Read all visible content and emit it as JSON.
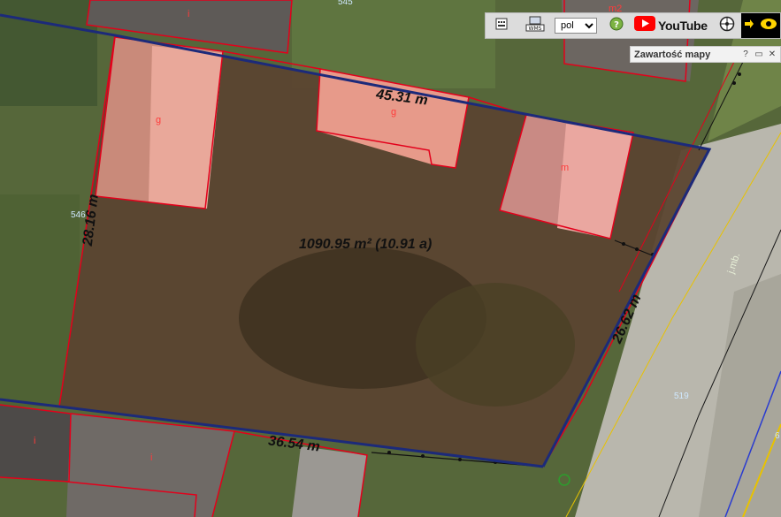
{
  "map": {
    "dimensions": {
      "top": "45.31 m",
      "left": "28.16 m",
      "right": "26.62 m",
      "bottom": "36.54 m"
    },
    "area": "1090.95 m² (10.91 a)",
    "plot_numbers": {
      "north": "545",
      "west": "546",
      "east": "519",
      "edge": "6"
    },
    "use_symbols": [
      "i",
      "g",
      "g",
      "m",
      "m2",
      "i",
      "i"
    ],
    "street_label": "j.mb."
  },
  "toolbar": {
    "language_value": "pol",
    "language_options": [
      "pol"
    ],
    "wms_label": "WMS",
    "youtube_label": "YouTube"
  },
  "contents_panel": {
    "title": "Zawartość mapy",
    "help": "?",
    "minimize": "▭",
    "close": "✕"
  },
  "colors": {
    "parcel_outline": "#1c2a7a",
    "building_outline": "#e3001b",
    "road_line": "#e8c200",
    "toolbar_bg": "#dcdcdc"
  }
}
